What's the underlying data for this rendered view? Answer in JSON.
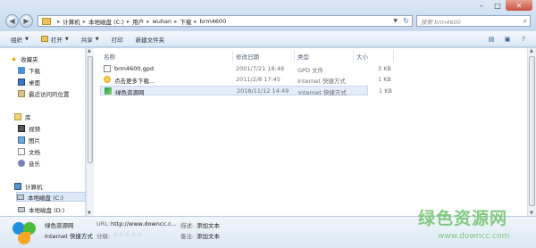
{
  "address": {
    "segments": [
      "计算机",
      "本地磁盘 (C:)",
      "用户",
      "wuhan",
      "下载",
      "brm4600"
    ],
    "separator": "▸"
  },
  "search": {
    "placeholder": "搜索 brm4600"
  },
  "toolbar": {
    "organize": "组织",
    "open": "打开",
    "share": "共享",
    "print": "打印",
    "new_folder": "新建文件夹"
  },
  "nav": {
    "favorites": "收藏夹",
    "downloads": "下载",
    "desktop": "桌面",
    "recent": "最近访问的位置",
    "library": "库",
    "videos": "视频",
    "pictures": "图片",
    "documents": "文档",
    "music": "音乐",
    "computer": "计算机",
    "disk_c": "本地磁盘 (C:)",
    "disk_d": "本地磁盘 (D:)"
  },
  "columns": {
    "name": "名称",
    "date": "修改日期",
    "type": "类型",
    "size": "大小"
  },
  "files": [
    {
      "name": "brm4600.gpd",
      "date": "2001/7/21 18:48",
      "type": "GPD 文件",
      "size": "3 KB"
    },
    {
      "name": "点击更多下载...",
      "date": "2011/2/8 17:45",
      "type": "Internet 快捷方式",
      "size": "1 KB"
    },
    {
      "name": "绿色资源网",
      "date": "2018/11/12 14:49",
      "type": "Internet 快捷方式",
      "size": "1 KB"
    }
  ],
  "details": {
    "name": "绿色资源网",
    "kind": "Internet 快捷方式",
    "url_label": "URL:",
    "url_value": "http://www.downcc.c...",
    "rating_label": "分级:",
    "desc_label": "描述:",
    "desc_value": "添加文本",
    "remark_label": "备注:",
    "remark_value": "添加文本"
  },
  "watermark": {
    "line1": "绿色资源网",
    "line2": "www.downcc.com"
  },
  "colors": {
    "accent": "#3a78c4",
    "watermark": "#6ec26a"
  }
}
